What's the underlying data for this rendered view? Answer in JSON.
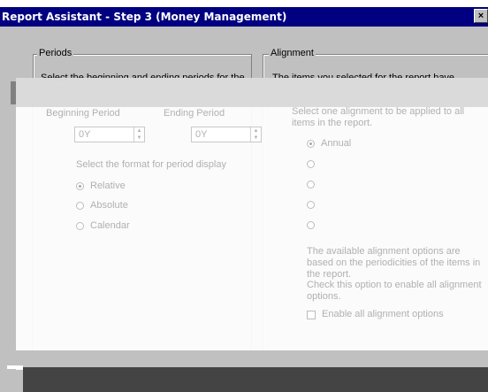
{
  "window": {
    "title": "Report Assistant - Step 3   (Money Management)",
    "close_label": "×"
  },
  "periods": {
    "group_title": "Periods",
    "instruction": "Select the beginning and ending periods for the report",
    "beginning_label": "Beginning Period",
    "ending_label": "Ending Period",
    "beginning_value": "0Y",
    "ending_value": "0Y",
    "format_label": "Select the format for period display",
    "formats": [
      "Relative",
      "Absolute",
      "Calendar"
    ],
    "selected_format": "Relative"
  },
  "alignment": {
    "group_title": "Alignment",
    "instruction": "The items you selected for the report have different periodicities.",
    "select_prompt": "Select one alignment to be applied to all items in the report.",
    "options": [
      "Annual",
      "",
      "",
      "",
      ""
    ],
    "selected_option": "Annual",
    "note": "The available alignment options are based on the periodicities of the items in the report.",
    "enable_note": "Check this option to enable all alignment options.",
    "enable_checkbox_label": "Enable all alignment options"
  }
}
